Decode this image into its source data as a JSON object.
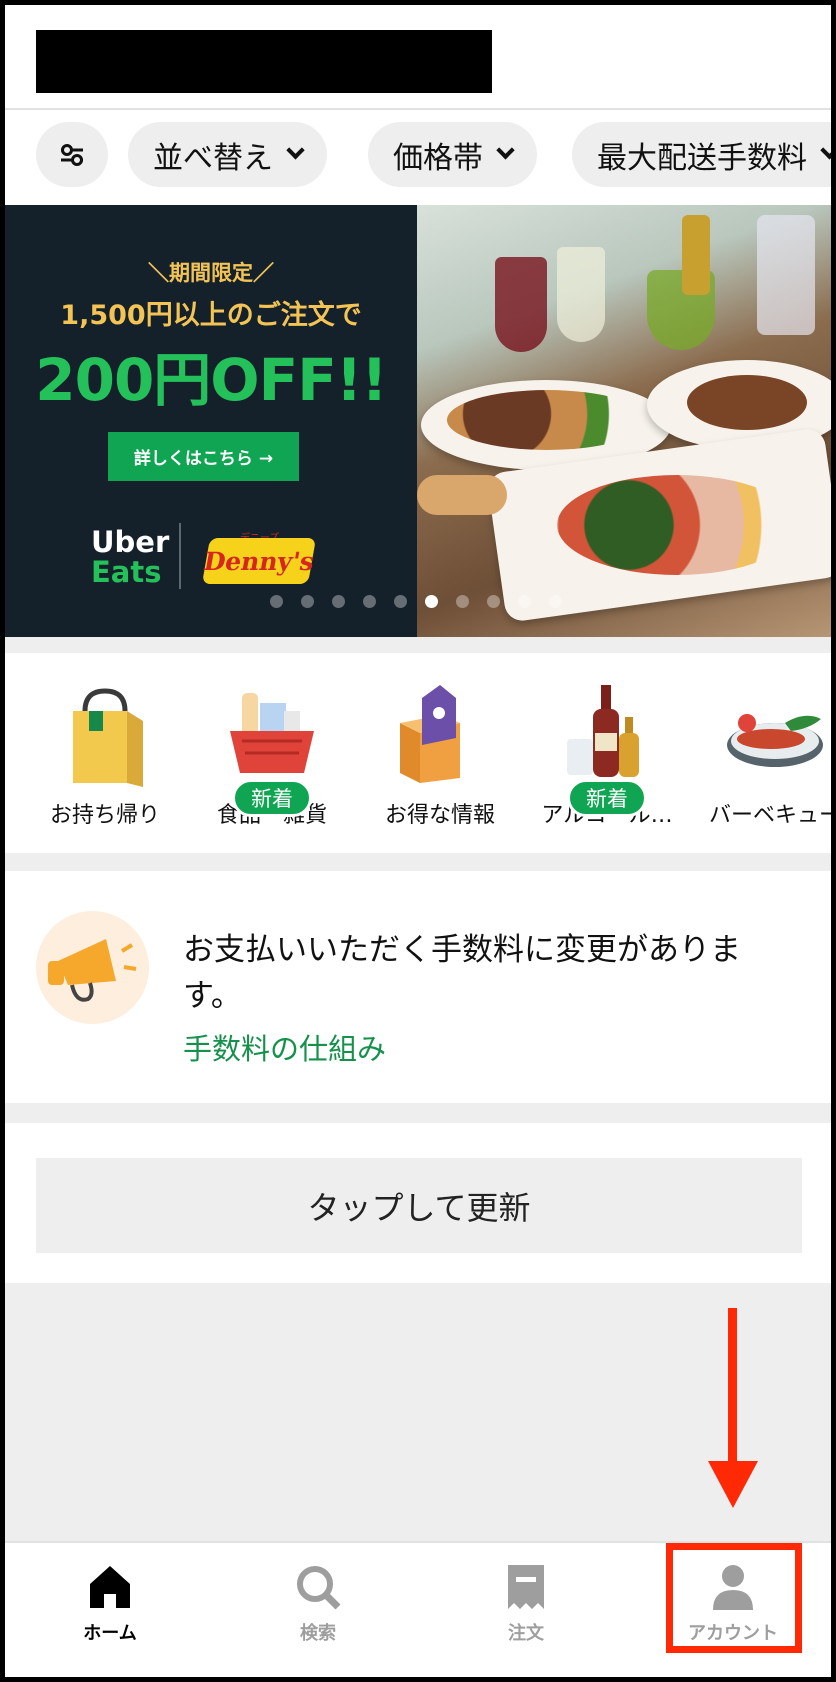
{
  "filters": {
    "filter_icon": "sliders-icon",
    "chips": [
      {
        "label": "並べ替え"
      },
      {
        "label": "価格帯"
      },
      {
        "label": "最大配送手数料"
      }
    ]
  },
  "banner": {
    "tag": "＼期間限定／",
    "line2": "1,500円以上のご注文で",
    "headline": "200円OFF!!",
    "button_label": "詳しくはこちら →",
    "brand_uber": "Uber",
    "brand_eats": "Eats",
    "partner_sub": "デニーズ",
    "partner": "Denny's",
    "carousel": {
      "total": 10,
      "active": 6
    }
  },
  "categories": [
    {
      "label": "お持ち帰り",
      "icon": "takeout-bag-icon",
      "new": false
    },
    {
      "label": "食品・雑貨",
      "icon": "grocery-basket-icon",
      "new": true,
      "badge": "新着"
    },
    {
      "label": "お得な情報",
      "icon": "deal-tag-box-icon",
      "new": false
    },
    {
      "label": "アルコール…",
      "icon": "alcohol-bottles-icon",
      "new": true,
      "badge": "新着"
    },
    {
      "label": "バーベキュー",
      "icon": "bbq-plate-icon",
      "new": false
    }
  ],
  "notice": {
    "icon": "megaphone-icon",
    "text": "お支払いいただく手数料に変更があります。",
    "link": "手数料の仕組み"
  },
  "refresh": {
    "label": "タップして更新"
  },
  "bottom_nav": [
    {
      "label": "ホーム",
      "icon": "home-icon",
      "active": true
    },
    {
      "label": "検索",
      "icon": "search-icon",
      "active": false
    },
    {
      "label": "注文",
      "icon": "receipt-icon",
      "active": false
    },
    {
      "label": "アカウント",
      "icon": "account-icon",
      "active": false
    }
  ],
  "colors": {
    "accent_green": "#10a552",
    "banner_bg": "#14202a",
    "annotation_red": "#ff2a05"
  }
}
